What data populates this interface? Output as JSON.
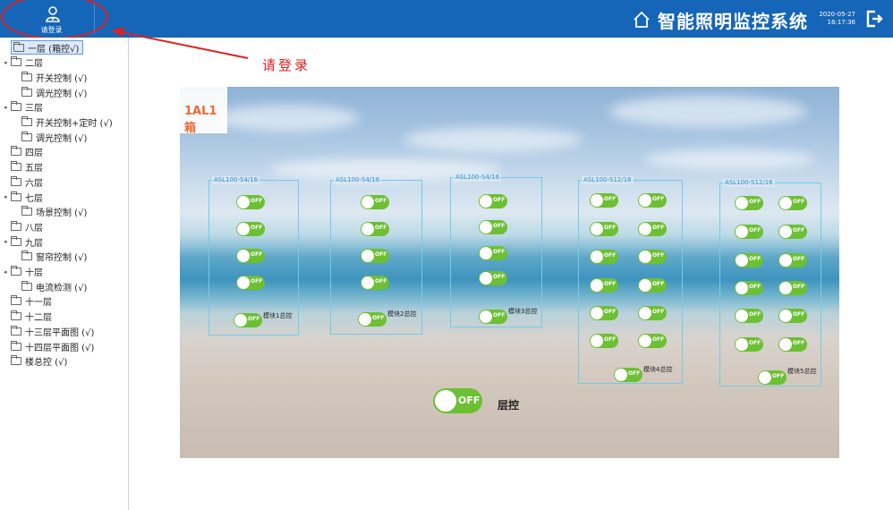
{
  "header": {
    "login_label": "请登录",
    "title": "智能照明监控系统",
    "date": "2020-05-27",
    "time": "16:17:36"
  },
  "icons": {
    "login": "user-icon",
    "home": "home-icon",
    "logout": "logout-icon",
    "folder": "folder-icon"
  },
  "colors": {
    "header_bg": "#1565b8",
    "annotation": "#e0201f",
    "toggle_on": "#6cc033",
    "module_border": "#74cbe9",
    "box_tag": "#f06a30"
  },
  "annotation": {
    "text": "请登录"
  },
  "sidebar": {
    "items": [
      {
        "label": "一层 (箱控√)",
        "selected": true
      },
      {
        "label": "二层",
        "arrow": "◂"
      },
      {
        "label": "开关控制 (√)"
      },
      {
        "label": "调光控制 (√)"
      },
      {
        "label": "三层",
        "arrow": "◂"
      },
      {
        "label": "开关控制+定时 (√)"
      },
      {
        "label": "调光控制 (√)"
      },
      {
        "label": "四层"
      },
      {
        "label": "五层"
      },
      {
        "label": "六层"
      },
      {
        "label": "七层",
        "arrow": "◂"
      },
      {
        "label": "场景控制 (√)"
      },
      {
        "label": "八层"
      },
      {
        "label": "九层",
        "arrow": "◂"
      },
      {
        "label": "窗帘控制 (√)"
      },
      {
        "label": "十层",
        "arrow": "◂"
      },
      {
        "label": "电流检测 (√)"
      },
      {
        "label": "十一层"
      },
      {
        "label": "十二层"
      },
      {
        "label": "十三层平面图 (√)"
      },
      {
        "label": "十四层平面图 (√)"
      },
      {
        "label": "楼总控 (√)"
      }
    ]
  },
  "panel": {
    "box_name": "1AL1箱",
    "toggle_text": "OFF",
    "modules": [
      {
        "label": "ASL100-S4/16",
        "total_label": "模块1总控"
      },
      {
        "label": "ASL100-S4/16",
        "total_label": "模块2总控"
      },
      {
        "label": "ASL100-S4/16",
        "total_label": "模块3总控"
      },
      {
        "label": "ASL100-S12/16",
        "total_label": "模块4总控"
      },
      {
        "label": "ASL100-S12/16",
        "total_label": "模块5总控"
      }
    ],
    "floor_toggle_text": "OFF",
    "floor_label": "层控"
  }
}
